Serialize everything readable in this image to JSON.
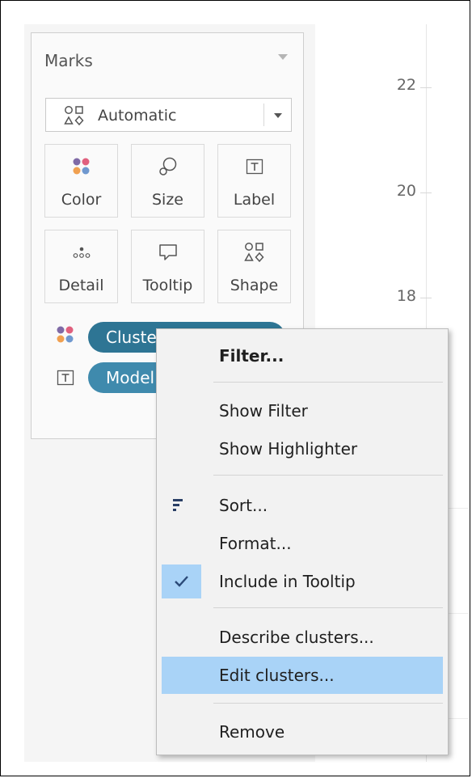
{
  "marks_card": {
    "title": "Marks",
    "mark_type": {
      "selected": "Automatic"
    },
    "shelves": [
      {
        "label": "Color",
        "icon": "color-icon"
      },
      {
        "label": "Size",
        "icon": "size-icon"
      },
      {
        "label": "Label",
        "icon": "label-icon"
      },
      {
        "label": "Detail",
        "icon": "detail-icon"
      },
      {
        "label": "Tooltip",
        "icon": "tooltip-icon"
      },
      {
        "label": "Shape",
        "icon": "shape-icon"
      }
    ],
    "pills": [
      {
        "text": "Clusters",
        "encoding": "color",
        "color": "#2e7594"
      },
      {
        "text": "Model",
        "encoding": "label",
        "color": "#3f8aad"
      }
    ]
  },
  "axis": {
    "ticks": [
      "22",
      "20",
      "18"
    ]
  },
  "context_menu": {
    "items": [
      {
        "label": "Filter...",
        "bold": true
      },
      {
        "label": "Show Filter"
      },
      {
        "label": "Show Highlighter"
      },
      {
        "label": "Sort...",
        "icon": "sort-icon"
      },
      {
        "label": "Format..."
      },
      {
        "label": "Include in Tooltip",
        "checked": true,
        "icon": "checkmark-icon"
      },
      {
        "label": "Describe clusters..."
      },
      {
        "label": "Edit clusters...",
        "highlighted": true
      },
      {
        "label": "Remove"
      }
    ]
  },
  "colors": {
    "menu_highlight": "#a9d3f7",
    "pill_dark": "#2e7594",
    "pill_light": "#3f8aad",
    "dot_purple": "#7f6aa6",
    "dot_pink": "#e0607e",
    "dot_orange": "#f0a050",
    "dot_blue": "#6f98cf"
  }
}
